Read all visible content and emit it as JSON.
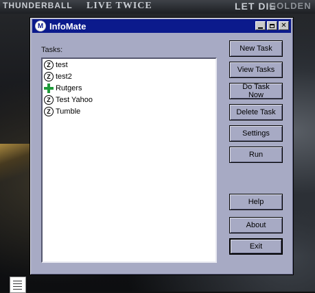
{
  "desktop": {
    "poster_texts": [
      "THUNDERBALL",
      "LIVE TWICE",
      "LET DIE",
      "GOLDEN"
    ]
  },
  "window": {
    "title": "InfoMate",
    "logo_letter": "M",
    "controls": {
      "minimize": "",
      "maximize": "",
      "close": "✕"
    }
  },
  "tasks": {
    "label": "Tasks:",
    "items": [
      {
        "label": "test",
        "icon": "z-task-icon"
      },
      {
        "label": "test2",
        "icon": "z-task-icon"
      },
      {
        "label": "Rutgers",
        "icon": "green-plus-icon"
      },
      {
        "label": "Test Yahoo",
        "icon": "z-task-icon"
      },
      {
        "label": "Tumble",
        "icon": "z-task-icon"
      }
    ]
  },
  "buttons": {
    "new_task": "New Task",
    "view_tasks": "View Tasks",
    "do_task_now": "Do Task Now",
    "delete_task": "Delete Task",
    "settings": "Settings",
    "run": "Run",
    "help": "Help",
    "about": "About",
    "exit": "Exit"
  },
  "colors": {
    "titlebar": "#0b1a8c",
    "window_face": "#a7aac4",
    "plus_icon": "#1e9a3a"
  }
}
